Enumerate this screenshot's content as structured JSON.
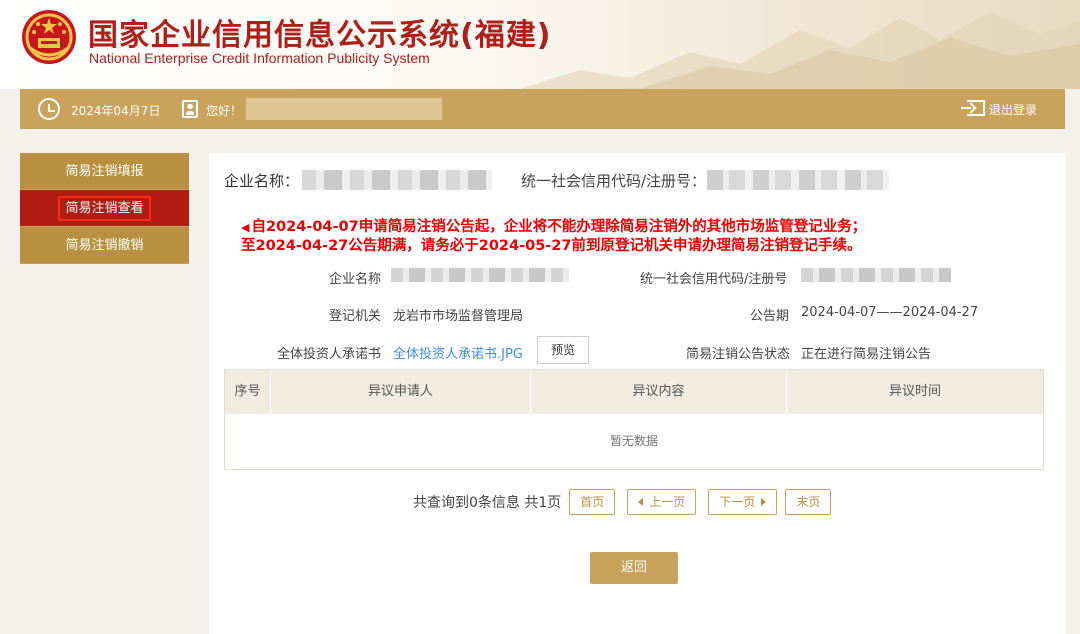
{
  "header": {
    "title": "国家企业信用信息公示系统(福建)",
    "subtitle": "National Enterprise Credit Information Publicity System"
  },
  "infobar": {
    "date": "2024年04月7日",
    "greeting": "您好！",
    "logout": "退出登录"
  },
  "sidebar": {
    "items": [
      {
        "label": "简易注销填报"
      },
      {
        "label": "简易注销查看"
      },
      {
        "label": "简易注销撤销"
      }
    ],
    "active_index": 1
  },
  "main": {
    "enterprise_label": "企业名称：",
    "credit_code_label": "统一社会信用代码/注册号：",
    "warning_line1": "自2024-04-07申请简易注销公告起，企业将不能办理除简易注销外的其他市场监管登记业务；",
    "warning_line2": "至2024-04-27公告期满，请务必于2024-05-27前到原登记机关申请办理简易注销登记手续。",
    "fields": {
      "company_name_label": "企业名称",
      "credit_code_label": "统一社会信用代码/注册号",
      "registry_label": "登记机关",
      "registry_value": "龙岩市市场监督管理局",
      "period_label": "公告期",
      "period_value": "2024-04-07——2024-04-27",
      "commitment_label": "全体投资人承诺书",
      "commitment_file": "全体投资人承诺书.JPG",
      "preview_button": "预览",
      "status_label": "简易注销公告状态",
      "status_value": "正在进行简易注销公告"
    },
    "table": {
      "columns": [
        "序号",
        "异议申请人",
        "异议内容",
        "异议时间"
      ],
      "empty_text": "暂无数据"
    },
    "pager": {
      "summary": "共查询到0条信息 共1页",
      "first": "首页",
      "prev": "上一页",
      "next": "下一页",
      "last": "末页"
    },
    "back_button": "返回"
  },
  "colors": {
    "brand_red": "#b11d17",
    "gold": "#c9a25b",
    "warning_red": "#e00000",
    "link_blue": "#3d8ee0"
  }
}
